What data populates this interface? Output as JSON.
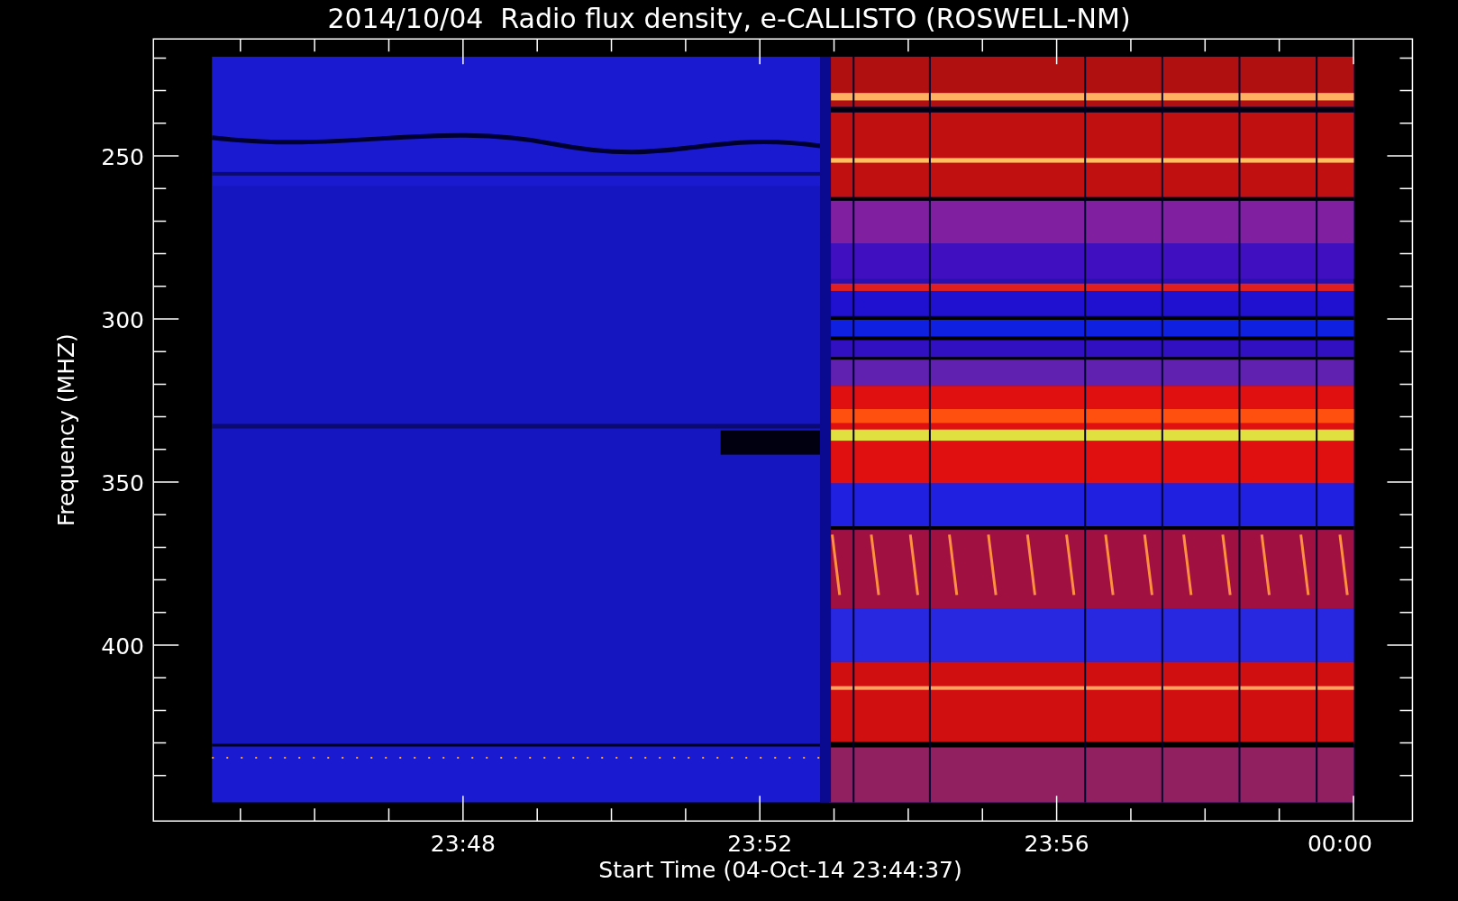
{
  "plot": {
    "title": "2014/10/04  Radio flux density, e-CALLISTO (ROSWELL-NM)",
    "ylabel": "Frequency (MHZ)",
    "xlabel": "Start Time (04-Oct-14 23:44:37)",
    "yticks": [
      "250",
      "300",
      "350",
      "400"
    ],
    "xticks": [
      "23:48",
      "23:52",
      "23:56",
      "00:00"
    ]
  }
}
